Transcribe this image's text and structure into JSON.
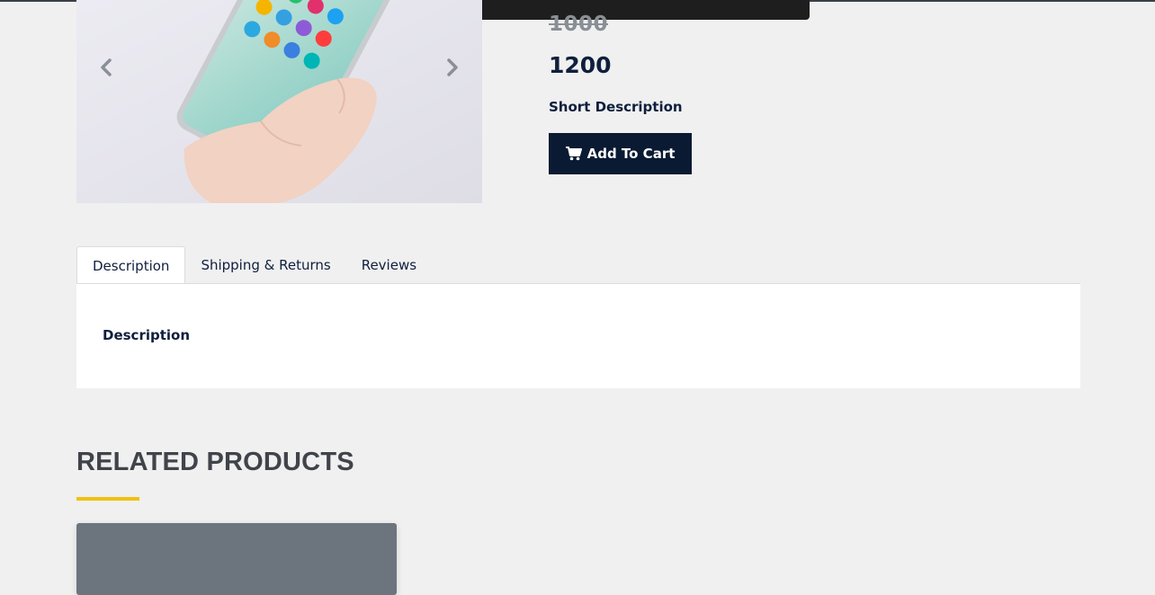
{
  "product": {
    "old_price": "1000",
    "price": "1200",
    "short_description_label": "Short Description",
    "add_to_cart_label": "Add To Cart"
  },
  "carousel": {
    "prev_icon": "chevron-left-icon",
    "next_icon": "chevron-right-icon"
  },
  "tabs": [
    {
      "label": "Description",
      "active": true
    },
    {
      "label": "Shipping & Returns",
      "active": false
    },
    {
      "label": "Reviews",
      "active": false
    }
  ],
  "tab_panel": {
    "heading": "Description"
  },
  "related": {
    "title": "RELATED PRODUCTS"
  },
  "colors": {
    "primary": "#0a1a33",
    "accent": "#f2c10f",
    "page_bg": "#f0f0f0",
    "card_bg": "#6c747e"
  }
}
